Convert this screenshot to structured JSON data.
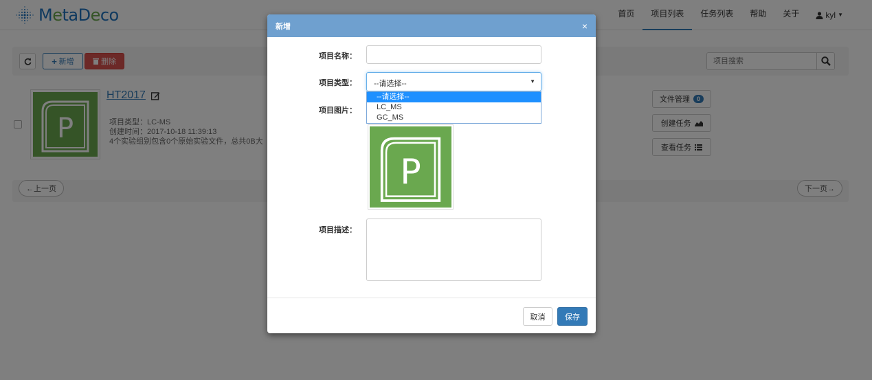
{
  "brand": {
    "logo_text_a": "M",
    "logo_text_b": "ta",
    "logo_text_c": "D",
    "logo_text_d": "co",
    "accent": "#1e73be",
    "green": "#6aa84f"
  },
  "nav": {
    "home": "首页",
    "projects": "项目列表",
    "tasks": "任务列表",
    "help": "帮助",
    "about": "关于",
    "user": "kyl"
  },
  "toolbar": {
    "add_label": "新增",
    "delete_label": "删除",
    "search_placeholder": "项目搜索"
  },
  "project": {
    "title": "HT2017",
    "type_line": "项目类型：LC-MS",
    "created_line": "创建时间：2017-10-18 11:39:13",
    "summary_line": "4个实验组别包含0个原始实验文件，总共0B大",
    "file_mgmt": "文件管理",
    "file_count": "0",
    "create_task": "创建任务",
    "view_task": "查看任务"
  },
  "pager": {
    "prev": "←上一页",
    "next": "下一页→"
  },
  "modal": {
    "title": "新增",
    "close": "×",
    "name_label": "项目名称：",
    "type_label": "项目类型：",
    "image_label": "项目图片：",
    "desc_label": "项目描述：",
    "type_selected": "--请选择--",
    "type_options": [
      "--请选择--",
      "LC_MS",
      "GC_MS"
    ],
    "cancel": "取消",
    "save": "保存"
  }
}
